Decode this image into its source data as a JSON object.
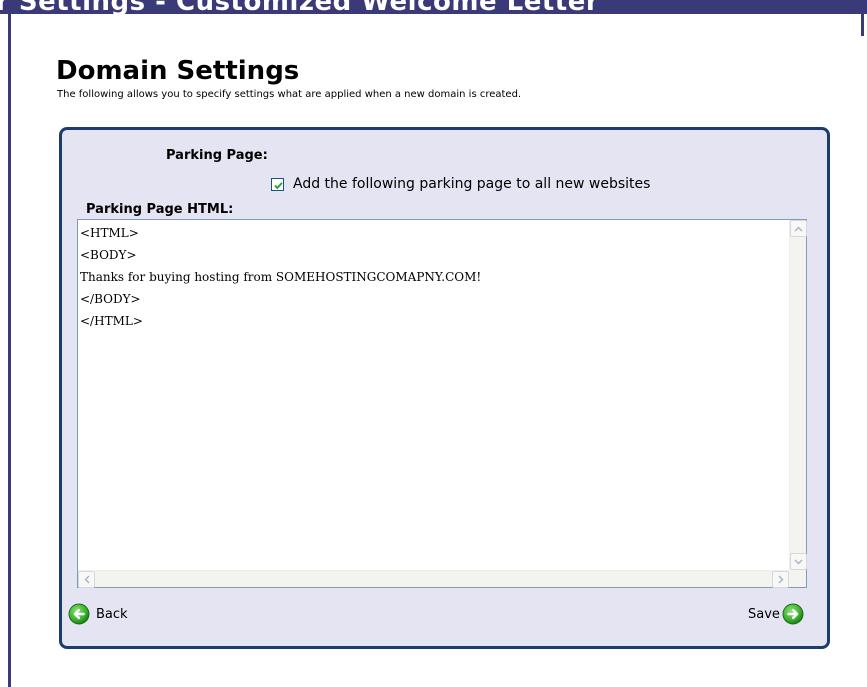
{
  "banner": {
    "title": "r Settings - Customized Welcome Letter"
  },
  "page": {
    "title": "Domain Settings",
    "description": "The following allows you to specify settings what are applied when a new domain is created."
  },
  "form": {
    "parking_label": "Parking Page:",
    "checkbox_label": "Add the following parking page to all new websites",
    "checkbox_checked": true,
    "html_label": "Parking Page HTML:",
    "html_value": "<HTML>\n<BODY>\nThanks for buying hosting from SOMEHOSTINGCOMAPNY.COM!\n</BODY>\n</HTML>"
  },
  "buttons": {
    "back_label": "Back",
    "save_label": "Save"
  },
  "icons": {
    "back": "arrow-left-circle-icon",
    "save": "arrow-right-circle-icon",
    "checkbox": "checkmark-icon"
  },
  "colors": {
    "frame": "#3a3a78",
    "panel_bg": "#e4e4f2",
    "panel_border": "#1d3c6e",
    "nav_icon_green": "#3cb82c"
  }
}
